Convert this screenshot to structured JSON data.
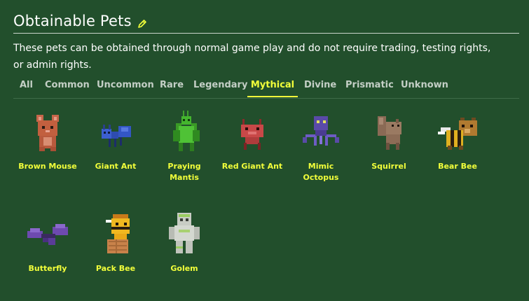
{
  "header": {
    "title": "Obtainable Pets",
    "edit_icon": "pencil-icon",
    "description": "These pets can be obtained through normal game play and do not require trading, testing rights, or admin rights."
  },
  "tabs": [
    {
      "label": "All",
      "active": false
    },
    {
      "label": "Common",
      "active": false
    },
    {
      "label": "Uncommon",
      "active": false
    },
    {
      "label": "Rare",
      "active": false
    },
    {
      "label": "Legendary",
      "active": false
    },
    {
      "label": "Mythical",
      "active": true
    },
    {
      "label": "Divine",
      "active": false
    },
    {
      "label": "Prismatic",
      "active": false
    },
    {
      "label": "Unknown",
      "active": false
    }
  ],
  "pets": [
    {
      "name": "Brown Mouse"
    },
    {
      "name": "Giant Ant"
    },
    {
      "name": "Praying Mantis"
    },
    {
      "name": "Red Giant Ant"
    },
    {
      "name": "Mimic Octopus"
    },
    {
      "name": "Squirrel"
    },
    {
      "name": "Bear Bee"
    },
    {
      "name": "Butterfly"
    },
    {
      "name": "Pack Bee"
    },
    {
      "name": "Golem"
    }
  ],
  "colors": {
    "background": "#224f2c",
    "accent": "#f2ff3a"
  }
}
